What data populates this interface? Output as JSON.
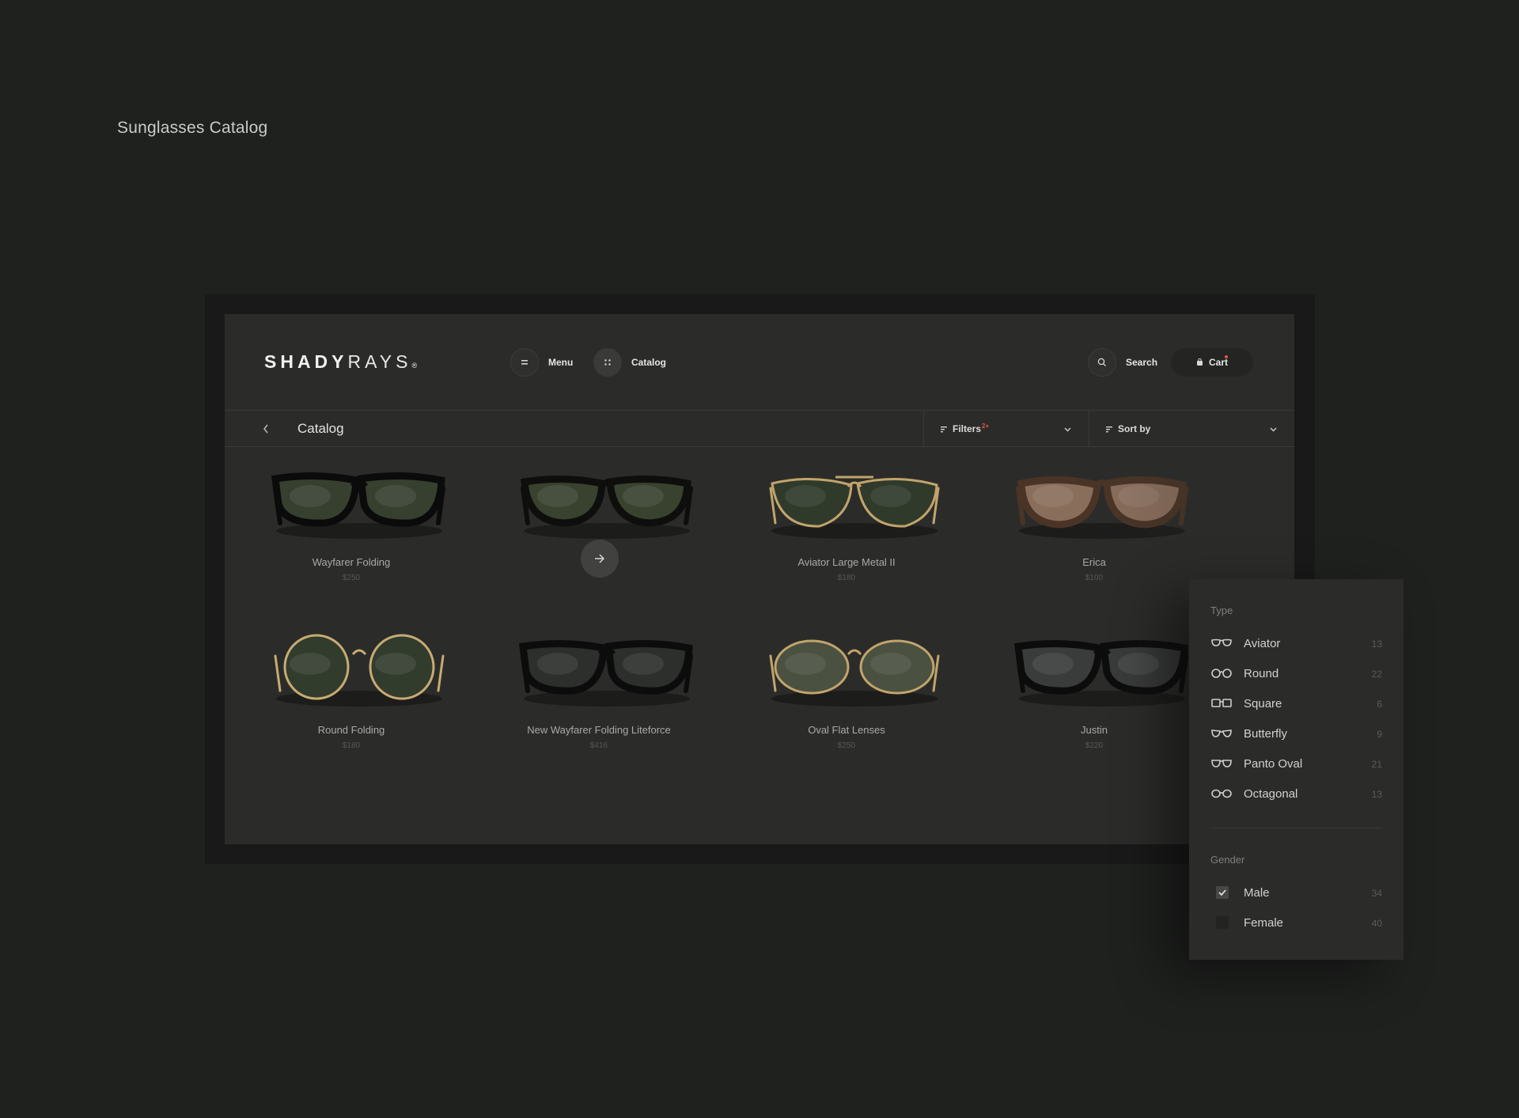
{
  "page_caption": "Sunglasses Catalog",
  "header": {
    "logo_bold": "SHADY",
    "logo_light": "RAYS",
    "logo_mark": "®",
    "menu_label": "Menu",
    "catalog_label": "Catalog",
    "search_label": "Search",
    "cart_label": "Cart"
  },
  "toolbar": {
    "title": "Catalog",
    "filters_label": "Filters",
    "filters_badge": "2+",
    "sort_label": "Sort by"
  },
  "products": [
    {
      "name": "Wayfarer Folding",
      "price": "$250",
      "style": "wayfarer",
      "lens": "#37402f",
      "frame": "#0b0b0b"
    },
    {
      "name": "",
      "price": "",
      "style": "clubmaster",
      "lens": "#39422f",
      "frame": "#0e0e0c"
    },
    {
      "name": "Aviator Large Metal II",
      "price": "$180",
      "style": "aviator",
      "lens": "#2f3a2b",
      "frame": "#c2a46b"
    },
    {
      "name": "Erica",
      "price": "$100",
      "style": "erica",
      "lens": "#8a6e5c",
      "frame": "#4a3426"
    },
    {
      "name": "Round Folding",
      "price": "$180",
      "style": "round",
      "lens": "#323c2d",
      "frame": "#c7ab72"
    },
    {
      "name": "New Wayfarer Folding Liteforce",
      "price": "$416",
      "style": "newwayfarer",
      "lens": "#2c2f2c",
      "frame": "#0c0c0c"
    },
    {
      "name": "Oval Flat Lenses",
      "price": "$250",
      "style": "oval",
      "lens": "#4a5140",
      "frame": "#c2a46b"
    },
    {
      "name": "Justin",
      "price": "$220",
      "style": "justin",
      "lens": "#3a3b3b",
      "frame": "#0c0c0c"
    }
  ],
  "filter_panel": {
    "type_heading": "Type",
    "types": [
      {
        "label": "Aviator",
        "count": "13",
        "icon": "aviator-glasses-icon"
      },
      {
        "label": "Round",
        "count": "22",
        "icon": "round-glasses-icon"
      },
      {
        "label": "Square",
        "count": "6",
        "icon": "square-glasses-icon"
      },
      {
        "label": "Butterfly",
        "count": "9",
        "icon": "butterfly-glasses-icon"
      },
      {
        "label": "Panto Oval",
        "count": "21",
        "icon": "panto-oval-glasses-icon"
      },
      {
        "label": "Octagonal",
        "count": "13",
        "icon": "octagonal-glasses-icon"
      }
    ],
    "gender_heading": "Gender",
    "genders": [
      {
        "label": "Male",
        "count": "34",
        "checked": true
      },
      {
        "label": "Female",
        "count": "40",
        "checked": false
      }
    ]
  },
  "colors": {
    "background": "#1f211f",
    "app_surface": "#2b2c2a",
    "accent": "#e0573e"
  }
}
